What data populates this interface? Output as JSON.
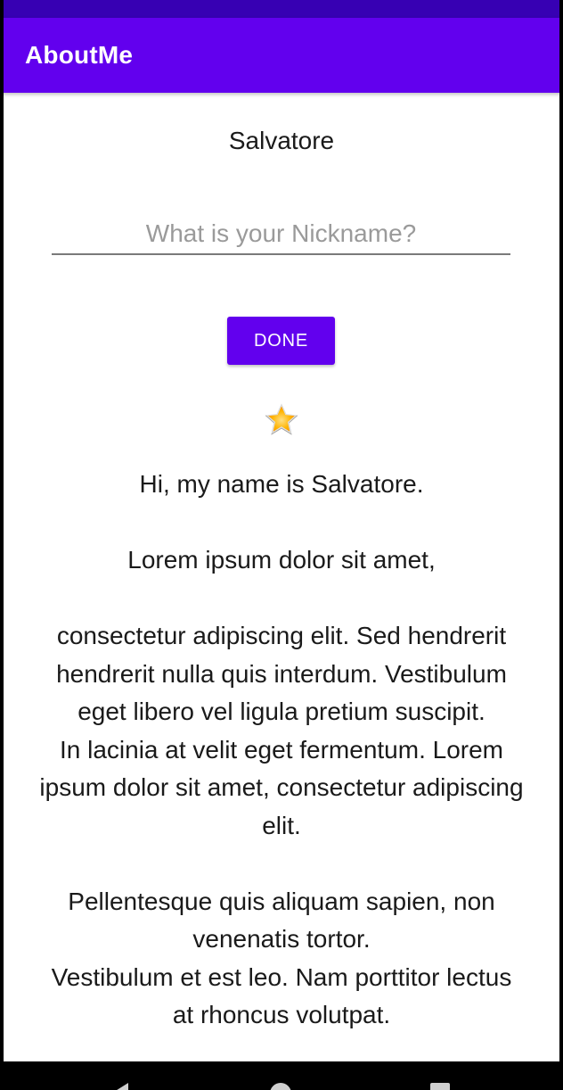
{
  "app": {
    "title": "AboutMe"
  },
  "profile": {
    "name": "Salvatore"
  },
  "nickname": {
    "value": "",
    "placeholder": "What is your Nickname?"
  },
  "actions": {
    "done_label": "DONE"
  },
  "icons": {
    "star": "star-icon",
    "nav_back": "back-icon",
    "nav_home": "home-icon",
    "nav_recents": "recents-icon"
  },
  "bio": {
    "text": "Hi, my name is Salvatore.\n\nLorem ipsum dolor sit amet,\n\nconsectetur adipiscing elit. Sed hendrerit hendrerit nulla quis interdum. Vestibulum eget libero vel ligula pretium suscipit.\nIn lacinia at velit eget fermentum. Lorem ipsum dolor sit amet, consectetur adipiscing elit.\n\nPellentesque quis aliquam sapien, non venenatis tortor.\nVestibulum et est leo. Nam porttitor lectus at rhoncus volutpat."
  },
  "colors": {
    "primary": "#6200ee",
    "primary_dark": "#3700b3",
    "on_primary": "#ffffff",
    "star": "#ffb300"
  }
}
